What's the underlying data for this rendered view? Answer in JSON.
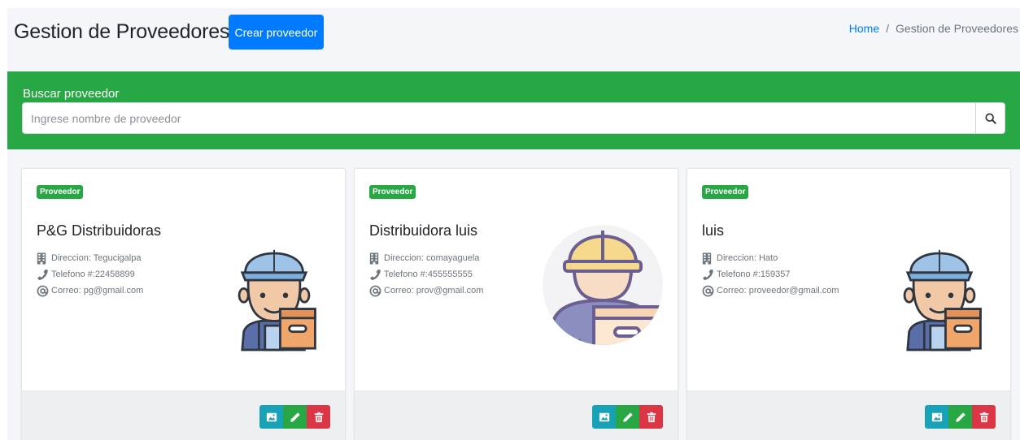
{
  "header": {
    "title": "Gestion de Proveedores",
    "create_button": "Crear proveedor",
    "breadcrumb": {
      "home": "Home",
      "separator": "/",
      "current": "Gestion de Proveedores"
    }
  },
  "search": {
    "label": "Buscar proveedor",
    "placeholder": "Ingrese nombre de proveedor",
    "value": "",
    "button_icon": "search-icon"
  },
  "cards": [
    {
      "badge": "Proveedor",
      "name": "P&G Distribuidoras",
      "direccion": "Direccion: Tegucigalpa",
      "telefono": "Telefono #:22458899",
      "correo": "Correo: pg@gmail.com",
      "avatar": "delivery-man-cap-icon"
    },
    {
      "badge": "Proveedor",
      "name": "Distribuidora luis",
      "direccion": "Direccion: comayaguela",
      "telefono": "Telefono #:455555555",
      "correo": "Correo: prov@gmail.com",
      "avatar": "delivery-man-helmet-icon"
    },
    {
      "badge": "Proveedor",
      "name": "luis",
      "direccion": "Direccion: Hato",
      "telefono": "Telefono #:159357",
      "correo": "Correo: proveedor@gmail.com",
      "avatar": "delivery-man-cap-icon"
    }
  ],
  "actions": [
    "image-icon",
    "pencil-icon",
    "trash-icon"
  ],
  "colors": {
    "primary": "#007bff",
    "success": "#28a745",
    "info": "#17a2b8",
    "danger": "#dc3545",
    "background": "#f4f6f9"
  }
}
